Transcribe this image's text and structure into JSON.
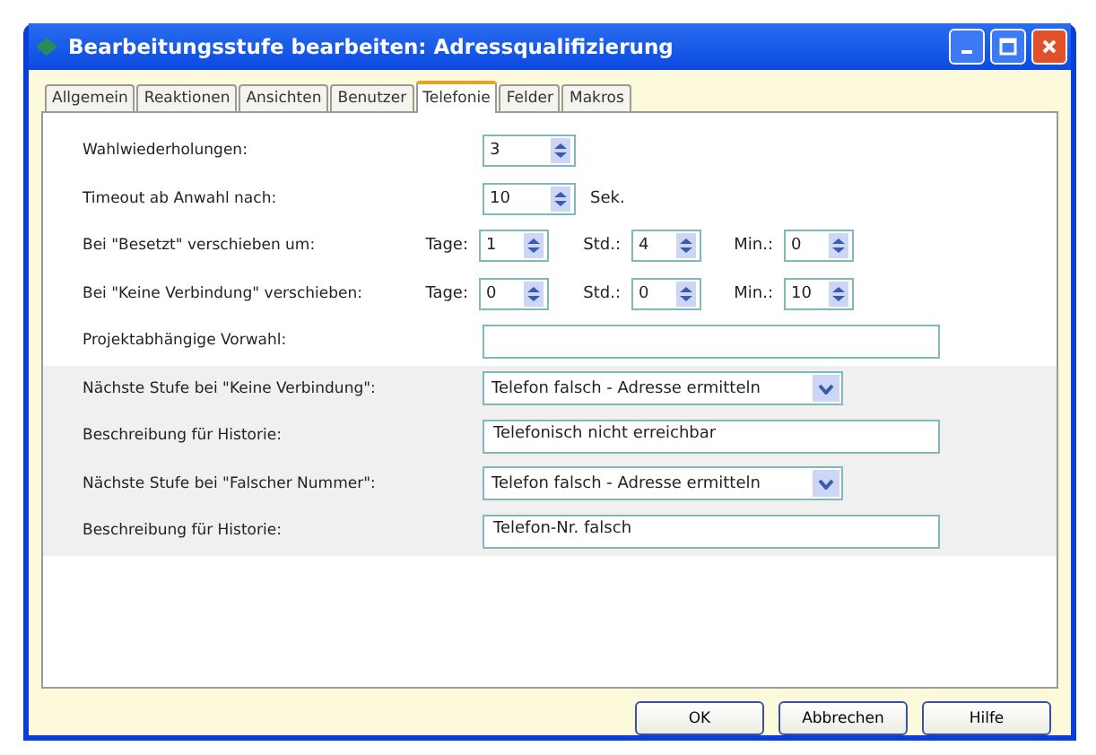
{
  "window": {
    "title": "Bearbeitungsstufe bearbeiten: Adressqualifizierung"
  },
  "tabs": [
    {
      "label": "Allgemein",
      "selected": false
    },
    {
      "label": "Reaktionen",
      "selected": false
    },
    {
      "label": "Ansichten",
      "selected": false
    },
    {
      "label": "Benutzer",
      "selected": false
    },
    {
      "label": "Telefonie",
      "selected": true
    },
    {
      "label": "Felder",
      "selected": false
    },
    {
      "label": "Makros",
      "selected": false
    }
  ],
  "rows": [
    {
      "kind": "spinner",
      "label": "Wahlwiederholungen:",
      "value": "3",
      "unit": ""
    },
    {
      "kind": "spinner",
      "label": "Timeout ab Anwahl nach:",
      "value": "10",
      "unit": "Sek."
    },
    {
      "kind": "triple",
      "label": "Bei \"Besetzt\" verschieben um:",
      "parts": [
        {
          "label": "Tage:",
          "value": "1"
        },
        {
          "label": "Std.:",
          "value": "4"
        },
        {
          "label": "Min.:",
          "value": "0"
        }
      ]
    },
    {
      "kind": "triple",
      "label": "Bei \"Keine Verbindung\" verschieben:",
      "parts": [
        {
          "label": "Tage:",
          "value": "0"
        },
        {
          "label": "Std.:",
          "value": "0"
        },
        {
          "label": "Min.:",
          "value": "10"
        }
      ]
    },
    {
      "kind": "text",
      "label": "Projektabhängige Vorwahl:",
      "value": ""
    },
    {
      "kind": "combo",
      "label": "Nächste Stufe bei \"Keine Verbindung\":",
      "value": "Telefon falsch - Adresse ermitteln"
    },
    {
      "kind": "text",
      "label": "Beschreibung für Historie:",
      "value": "Telefonisch nicht erreichbar"
    },
    {
      "kind": "combo",
      "label": "Nächste Stufe bei \"Falscher Nummer\":",
      "value": "Telefon falsch - Adresse ermitteln"
    },
    {
      "kind": "text",
      "label": "Beschreibung für Historie:",
      "value": "Telefon-Nr. falsch"
    }
  ],
  "buttons": [
    "OK",
    "Abbrechen",
    "Hilfe"
  ]
}
